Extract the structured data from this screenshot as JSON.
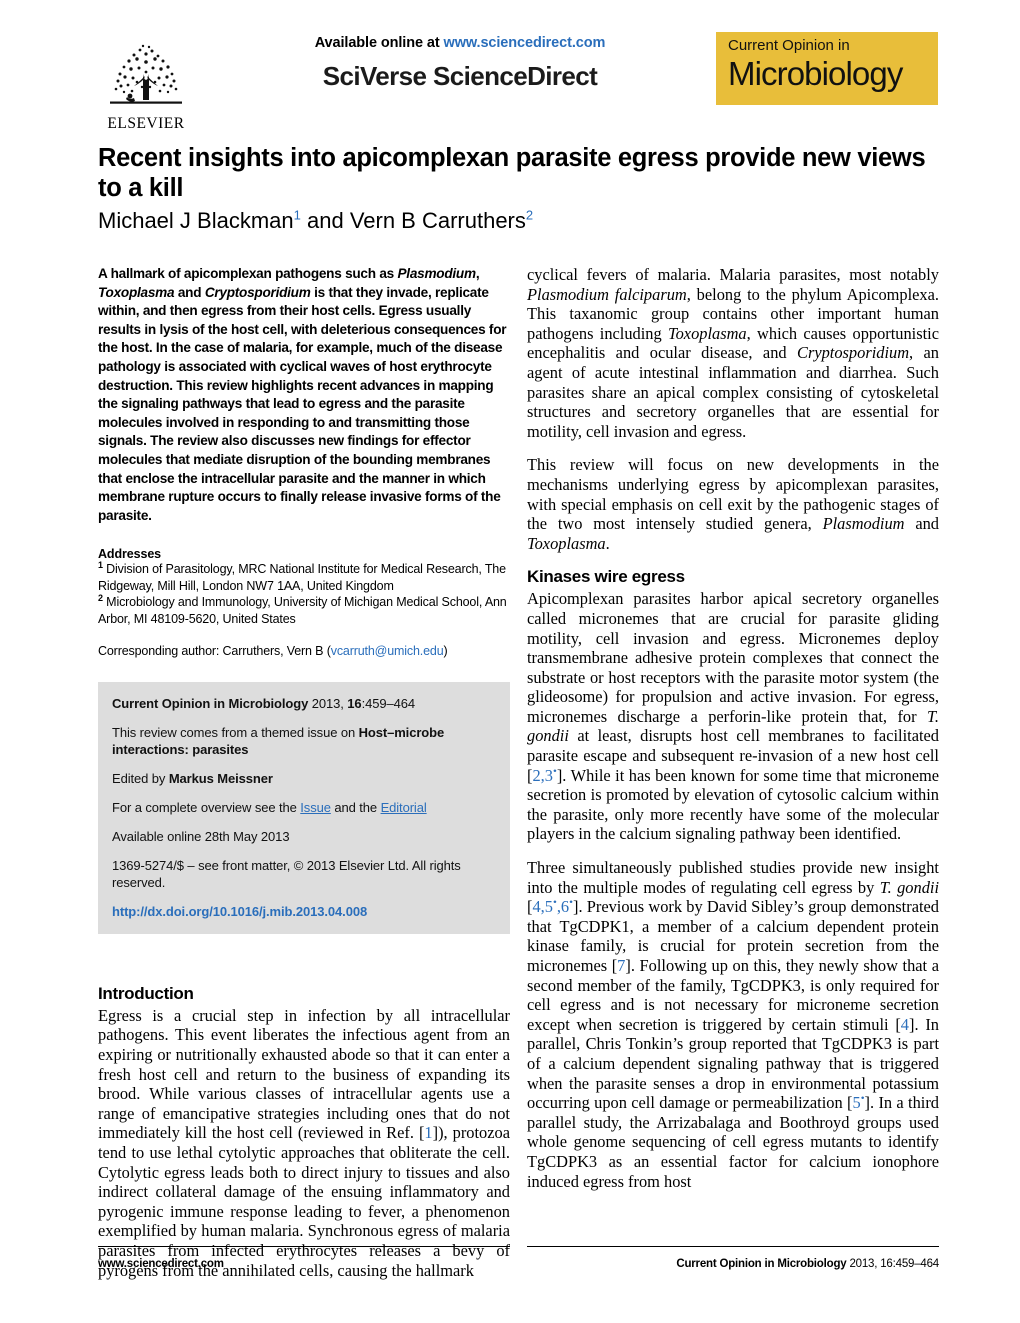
{
  "masthead": {
    "available_prefix": "Available online at ",
    "sciencedirect_url": "www.sciencedirect.com",
    "platform": "SciVerse ScienceDirect",
    "publisher": "ELSEVIER",
    "journal_logo_top": "Current Opinion in",
    "journal_logo_main": "Microbiology",
    "logo_color": "#e8be3a",
    "link_color": "#2a6ebb"
  },
  "title": "Recent insights into apicomplexan parasite egress provide new views to a kill",
  "authors": {
    "author1": "Michael J Blackman",
    "author1_affil": "1",
    "conjunction": " and ",
    "author2": "Vern B Carruthers",
    "author2_affil": "2"
  },
  "abstract": {
    "p1_a": "A hallmark of apicomplexan pathogens such as ",
    "i1": "Plasmodium",
    "p1_b": ", ",
    "i2": "Toxoplasma",
    "p1_c": " and ",
    "i3": "Cryptosporidium",
    "p1_d": " is that they invade, replicate within, and then egress from their host cells. Egress usually results in lysis of the host cell, with deleterious consequences for the host. In the case of malaria, for example, much of the disease pathology is associated with cyclical waves of host erythrocyte destruction. This review highlights recent advances in mapping the signaling pathways that lead to egress and the parasite molecules involved in responding to and transmitting those signals. The review also discusses new findings for effector molecules that mediate disruption of the bounding membranes that enclose the intracellular parasite and the manner in which membrane rupture occurs to finally release invasive forms of the parasite."
  },
  "addresses": {
    "heading": "Addresses",
    "a1_sup": "1",
    "a1": " Division of Parasitology, MRC National Institute for Medical Research, The Ridgeway, Mill Hill, London NW7 1AA, United Kingdom",
    "a2_sup": "2",
    "a2": " Microbiology and Immunology, University of Michigan Medical School, Ann Arbor, MI 48109-5620, United States",
    "corresponding_prefix": "Corresponding author: Carruthers, Vern B (",
    "corresponding_email": "vcarruth@umich.edu",
    "corresponding_suffix": ")"
  },
  "infobox": {
    "citation_journal": "Current Opinion in Microbiology",
    "citation_rest_a": " 2013, ",
    "citation_volume": "16",
    "citation_rest_b": ":459–464",
    "themed_prefix": "This review comes from a themed issue on ",
    "themed_issue": "Host–microbe interactions: parasites",
    "edited_prefix": "Edited by ",
    "editor": "Markus Meissner",
    "overview_prefix": "For a complete overview see the ",
    "overview_link1": "Issue",
    "overview_mid": " and the ",
    "overview_link2": "Editorial",
    "available_online": "Available online 28th May 2013",
    "front_matter": "1369-5274/$ – see front matter, © 2013 Elsevier Ltd. All rights reserved.",
    "doi": "http://dx.doi.org/10.1016/j.mib.2013.04.008",
    "background_color": "#dddddd"
  },
  "left_column": {
    "intro_heading": "Introduction",
    "intro_p1_a": "Egress is a crucial step in infection by all intracellular pathogens. This event liberates the infectious agent from an expiring or nutritionally exhausted abode so that it can enter a fresh host cell and return to the business of expanding its brood. While various classes of intracellular agents use a range of emancipative strategies including ones that do not immediately kill the host cell (reviewed in Ref. [",
    "intro_ref1": "1",
    "intro_p1_b": "]), protozoa tend to use lethal cytolytic approaches that obliterate the cell. Cytolytic egress leads both to direct injury to tissues and also indirect collateral damage of the ensuing inflammatory and pyrogenic immune response leading to fever, a phenomenon exemplified by human malaria. Synchronous egress of malaria parasites from infected erythrocytes releases a bevy of pyrogens from the annihilated cells, causing the hallmark"
  },
  "right_column": {
    "p1_a": "cyclical fevers of malaria. Malaria parasites, most notably ",
    "p1_i1": "Plasmodium falciparum",
    "p1_b": ", belong to the phylum Apicomplexa. This taxanomic group contains other important human pathogens including ",
    "p1_i2": "Toxoplasma",
    "p1_c": ", which causes opportunistic encephalitis and ocular disease, and ",
    "p1_i3": "Cryptosporidium",
    "p1_d": ", an agent of acute intestinal inflammation and diarrhea. Such parasites share an apical complex consisting of cytoskeletal structures and secretory organelles that are essential for motility, cell invasion and egress.",
    "p2_a": "This review will focus on new developments in the mechanisms underlying egress by apicomplexan parasites, with special emphasis on cell exit by the pathogenic stages of the two most intensely studied genera, ",
    "p2_i1": "Plasmodium",
    "p2_b": " and ",
    "p2_i2": "Toxoplasma",
    "p2_c": ".",
    "kinases_heading": "Kinases wire egress",
    "p3_a": "Apicomplexan parasites harbor apical secretory organelles called micronemes that are crucial for parasite gliding motility, cell invasion and egress. Micronemes deploy transmembrane adhesive protein complexes that connect the substrate or host receptors with the parasite motor system (the glideosome) for propulsion and active invasion. For egress, micronemes discharge a perforin-like protein that, for ",
    "p3_i1": "T. gondii",
    "p3_b": " at least, disrupts host cell membranes to facilitated parasite escape and subsequent re-invasion of a new host cell [",
    "p3_ref": "2,3",
    "p3_ref_star": "•",
    "p3_c": "]. While it has been known for some time that microneme secretion is promoted by elevation of cytosolic calcium within the parasite, only more recently have some of the molecular players in the calcium signaling pathway been identified.",
    "p4_a": "Three simultaneously published studies provide new insight into the multiple modes of regulating cell egress by ",
    "p4_i1": "T. gondii",
    "p4_b": " [",
    "p4_ref": "4,5",
    "p4_star1": "•",
    "p4_ref2": ",6",
    "p4_star2": "•",
    "p4_c": "]. Previous work by David Sibley’s group demonstrated that TgCDPK1, a member of a calcium dependent protein kinase family, is crucial for protein secretion from the micronemes [",
    "p4_ref3": "7",
    "p4_d": "]. Following up on this, they newly show that a second member of the family, TgCDPK3, is only required for cell egress and is not necessary for microneme secretion except when secretion is triggered by certain stimuli [",
    "p4_ref4": "4",
    "p4_e": "]. In parallel, Chris Tonkin’s group reported that TgCDPK3 is part of a calcium dependent signaling pathway that is triggered when the parasite senses a drop in environmental potassium occurring upon cell damage or permeabilization [",
    "p4_ref5": "5",
    "p4_star3": "•",
    "p4_f": "]. In a third parallel study, the Arrizabalaga and Boothroyd groups used whole genome sequencing of cell egress mutants to identify TgCDPK3 as an essential factor for calcium ionophore induced egress from host"
  },
  "footer": {
    "left": "www.sciencedirect.com",
    "right_journal": "Current Opinion in Microbiology",
    "right_rest": " 2013, 16:459–464"
  }
}
